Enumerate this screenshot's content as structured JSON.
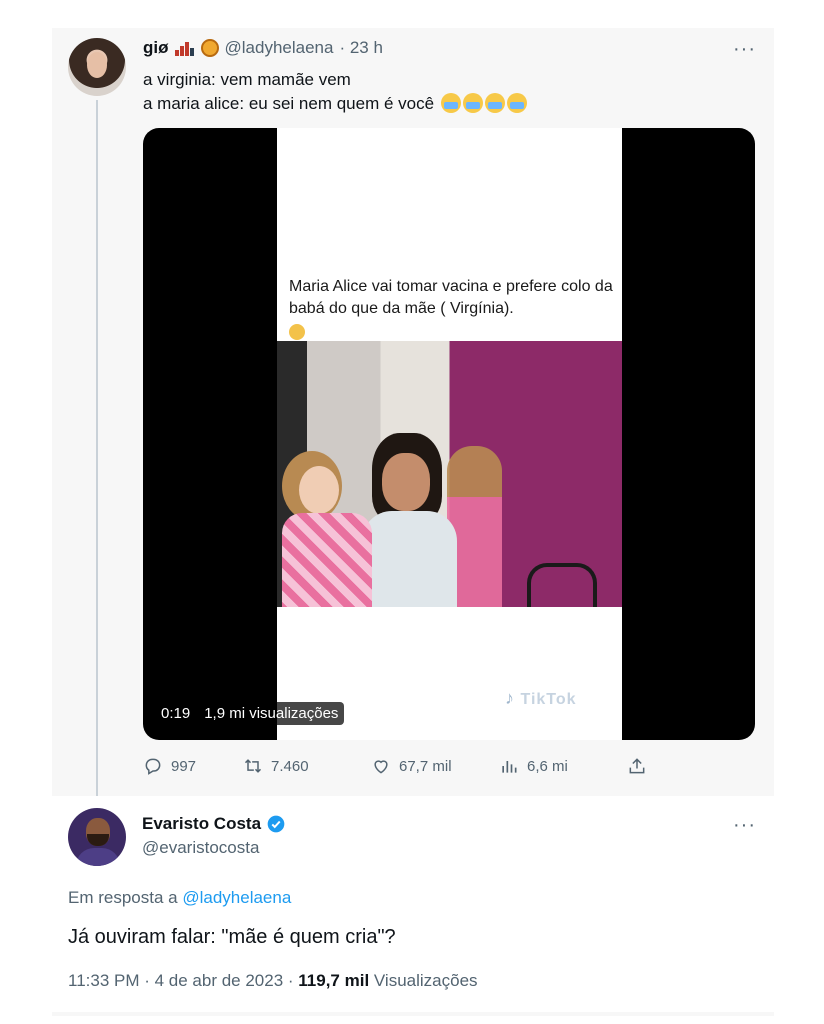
{
  "tweet1": {
    "name": "giø",
    "handle": "@ladyhelaena",
    "time": "· 23 h",
    "more": "···",
    "line1": "a virginia: vem mamãe vem",
    "line2": "a maria alice: eu sei nem quem é você",
    "media": {
      "caption": "Maria Alice vai tomar  vacina e prefere colo da babá do que da mãe ( Virgínia).",
      "duration": "0:19",
      "views": "1,9 mi visualizações",
      "watermark": "TikTok"
    },
    "actions": {
      "replies": "997",
      "retweets": "7.460",
      "likes": "67,7 mil",
      "views": "6,6 mi"
    }
  },
  "tweet2": {
    "name": "Evaristo Costa",
    "handle": "@evaristocosta",
    "more": "···",
    "reply_prefix": "Em resposta a",
    "reply_handle": "@ladyhelaena",
    "text": "Já ouviram falar: \"mãe é quem cria\"?",
    "timestamp": "11:33 PM · 4 de abr de 2023 · ",
    "views_count": "119,7 mil",
    "views_label": " Visualizações"
  },
  "colors": {
    "accent": "#1d9bf0",
    "secondary_text": "#536471"
  }
}
